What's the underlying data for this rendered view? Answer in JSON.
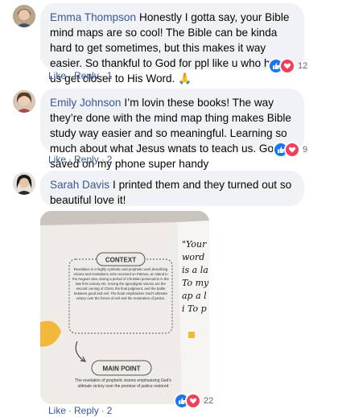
{
  "comments": [
    {
      "author": "Emma Thompson",
      "text": "Honestly I gotta say, your Bible mind maps are so cool! The Bible can be kinda hard to get sometimes, but this makes it way easier. So thankful to God for ppl like u who help us get closer to His Word. 🙏",
      "reaction_count": "12",
      "like_label": "Like",
      "reply_label": "Reply",
      "replies": "1"
    },
    {
      "author": "Emily Johnson",
      "text": "I’m lovin these books! The way they’re done with the mind map thing makes Bible study way easier and so meaningful. Learning so much about what Jesus wnats to teach us. Got it saved on my phone super handy",
      "reaction_count": "9",
      "like_label": "Like",
      "reply_label": "Reply",
      "replies": "2"
    },
    {
      "author": "Sarah Davis",
      "text": "I printed them and they turned out so beautiful love it!",
      "reaction_count": "22",
      "like_label": "Like",
      "reply_label": "Reply",
      "replies": "2"
    }
  ],
  "photo": {
    "context_heading": "CONTEXT",
    "context_text": "Revelation is a highly symbolic and prophetic work describing visions and revelations John received on Patmos, an island in the Aegean Sea, during a period of Christian persecution in the late first century AD. Among the apocalyptic visions are the second coming of Christ, the final judgment, and the battle between good and evil. The book emphasizes God’s ultimate victory over the forces of evil and the restoration of justice.",
    "mainpoint_heading": "MAIN POINT",
    "mainpoint_text": "The revelation of prophetic visions emphasizing God’s ultimate victory over the promise of justice restored",
    "right_page_text": "\"Your word is a la To my ap a li To p"
  },
  "colors": {
    "link": "#385898",
    "bubble": "#f0f2f5",
    "like": "#1877f2",
    "love": "#f33e58",
    "meta": "#65676b"
  }
}
